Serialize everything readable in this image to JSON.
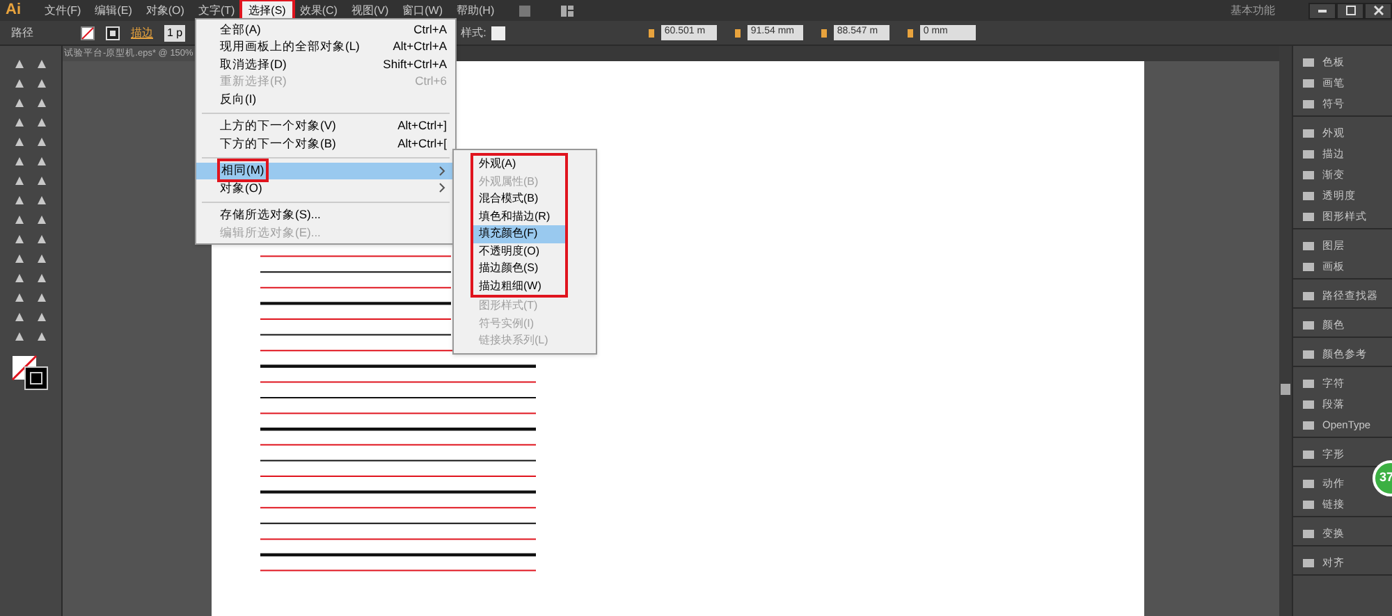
{
  "app": {
    "logo": "Ai",
    "menus": [
      {
        "label": "文件(F)",
        "selected": false,
        "annotated": false
      },
      {
        "label": "编辑(E)",
        "selected": false,
        "annotated": false
      },
      {
        "label": "对象(O)",
        "selected": false,
        "annotated": false
      },
      {
        "label": "文字(T)",
        "selected": false,
        "annotated": false
      },
      {
        "label": "选择(S)",
        "selected": true,
        "annotated": true
      },
      {
        "label": "效果(C)",
        "selected": false,
        "annotated": false
      },
      {
        "label": "视图(V)",
        "selected": false,
        "annotated": false
      },
      {
        "label": "窗口(W)",
        "selected": false,
        "annotated": false
      },
      {
        "label": "帮助(H)",
        "selected": false,
        "annotated": false
      }
    ],
    "workspace": "基本功能"
  },
  "control_bar": {
    "selection": "路径",
    "stroke_label": "描边",
    "stroke_weight": "1 p",
    "style_label": "样式:",
    "x": "60.501 m",
    "y": "91.54 mm",
    "w": "88.547 m",
    "h": "0 mm"
  },
  "document_tab": "试验平台-原型机.eps* @ 150%",
  "select_menu": [
    {
      "kind": "item",
      "label": "全部(A)",
      "shortcut": "Ctrl+A",
      "disabled": false,
      "selected": false,
      "submenu": false,
      "annotated": false
    },
    {
      "kind": "item",
      "label": "现用画板上的全部对象(L)",
      "shortcut": "Alt+Ctrl+A",
      "disabled": false,
      "selected": false,
      "submenu": false,
      "annotated": false
    },
    {
      "kind": "item",
      "label": "取消选择(D)",
      "shortcut": "Shift+Ctrl+A",
      "disabled": false,
      "selected": false,
      "submenu": false,
      "annotated": false
    },
    {
      "kind": "item",
      "label": "重新选择(R)",
      "shortcut": "Ctrl+6",
      "disabled": true,
      "selected": false,
      "submenu": false,
      "annotated": false
    },
    {
      "kind": "item",
      "label": "反向(I)",
      "disabled": false,
      "selected": false,
      "submenu": false,
      "annotated": false
    },
    {
      "kind": "separator"
    },
    {
      "kind": "item",
      "label": "上方的下一个对象(V)",
      "shortcut": "Alt+Ctrl+]",
      "disabled": false,
      "selected": false,
      "submenu": false,
      "annotated": false
    },
    {
      "kind": "item",
      "label": "下方的下一个对象(B)",
      "shortcut": "Alt+Ctrl+[",
      "disabled": false,
      "selected": false,
      "submenu": false,
      "annotated": false
    },
    {
      "kind": "separator"
    },
    {
      "kind": "item",
      "label": "相同(M)",
      "disabled": false,
      "selected": true,
      "submenu": true,
      "annotated": true
    },
    {
      "kind": "item",
      "label": "对象(O)",
      "disabled": false,
      "selected": false,
      "submenu": true,
      "annotated": false
    },
    {
      "kind": "separator"
    },
    {
      "kind": "item",
      "label": "存储所选对象(S)...",
      "disabled": false,
      "selected": false,
      "submenu": false,
      "annotated": false
    },
    {
      "kind": "item",
      "label": "编辑所选对象(E)...",
      "disabled": true,
      "selected": false,
      "submenu": false,
      "annotated": false
    }
  ],
  "same_submenu": [
    {
      "label": "外观(A)",
      "disabled": false,
      "selected": false,
      "annotated": true
    },
    {
      "label": "外观属性(B)",
      "disabled": true,
      "selected": false,
      "annotated": true
    },
    {
      "label": "混合模式(B)",
      "disabled": false,
      "selected": false,
      "annotated": true
    },
    {
      "label": "填色和描边(R)",
      "disabled": false,
      "selected": false,
      "annotated": true
    },
    {
      "label": "填充颜色(F)",
      "disabled": false,
      "selected": true,
      "annotated": true
    },
    {
      "label": "不透明度(O)",
      "disabled": false,
      "selected": false,
      "annotated": true
    },
    {
      "label": "描边颜色(S)",
      "disabled": false,
      "selected": false,
      "annotated": true
    },
    {
      "label": "描边粗细(W)",
      "disabled": false,
      "selected": false,
      "annotated": true
    },
    {
      "label": "图形样式(T)",
      "disabled": true,
      "selected": false,
      "annotated": false
    },
    {
      "label": "符号实例(I)",
      "disabled": true,
      "selected": false,
      "annotated": false
    },
    {
      "label": "链接块系列(L)",
      "disabled": true,
      "selected": false,
      "annotated": false
    }
  ],
  "panels": [
    [
      "色板",
      "画笔",
      "符号"
    ],
    [
      "外观",
      "描边",
      "渐变",
      "透明度",
      "图形样式"
    ],
    [
      "图层",
      "画板"
    ],
    [
      "路径查找器"
    ],
    [
      "颜色"
    ],
    [
      "颜色参考"
    ],
    [
      "字符",
      "段落",
      "OpenType"
    ],
    [
      "字形"
    ],
    [
      "动作",
      "链接"
    ],
    [
      "变换"
    ],
    [
      "对齐"
    ]
  ],
  "badge": "37"
}
